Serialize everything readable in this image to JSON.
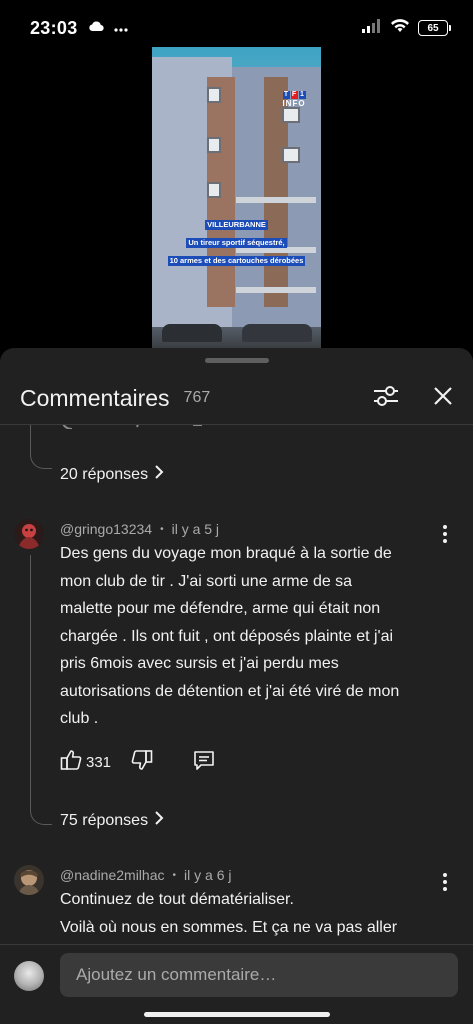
{
  "status_bar": {
    "time": "23:03",
    "battery": "65",
    "icons": [
      "cloud-icon",
      "more-dots-icon",
      "signal-icon",
      "wifi-icon",
      "battery-icon"
    ]
  },
  "video": {
    "channel_logo_top": "TF1",
    "channel_logo_bottom": "INFO",
    "caption_lines": [
      "VILLEURBANNE",
      "Un tireur sportif séquestré,",
      "10 armes et des cartouches dérobées"
    ]
  },
  "comments_panel": {
    "title": "Commentaires",
    "count": "767",
    "icons": [
      "filter-sliders-icon",
      "close-icon"
    ]
  },
  "threads": [
    {
      "replies_label": "20 réponses"
    }
  ],
  "comments": [
    {
      "author": "@gringo13234",
      "time": "il y a 5 j",
      "text_lines": [
        "Des gens du voyage mon braqué à la sortie de",
        "mon club de tir . J'ai sorti une arme de sa",
        "malette pour me défendre, arme qui était non",
        "chargée . Ils ont fuit , ont déposés plainte et j'ai",
        "pris 6mois avec sursis et j'ai perdu mes",
        "autorisations de détention et j'ai été viré de mon",
        "club ."
      ],
      "likes": "331",
      "replies_label": "75 réponses"
    },
    {
      "author": "@nadine2milhac",
      "time": "il y a 6 j",
      "text_lines": [
        "Continuez de tout dématérialiser.",
        "Voilà où nous en sommes. Et ça ne va pas aller"
      ]
    }
  ],
  "input": {
    "placeholder": "Ajoutez un commentaire…"
  },
  "colors": {
    "sheet_bg": "#212121",
    "text": "#f1f1f1",
    "muted": "#aaaaaa",
    "caption_bg": "#1c4cb8"
  }
}
